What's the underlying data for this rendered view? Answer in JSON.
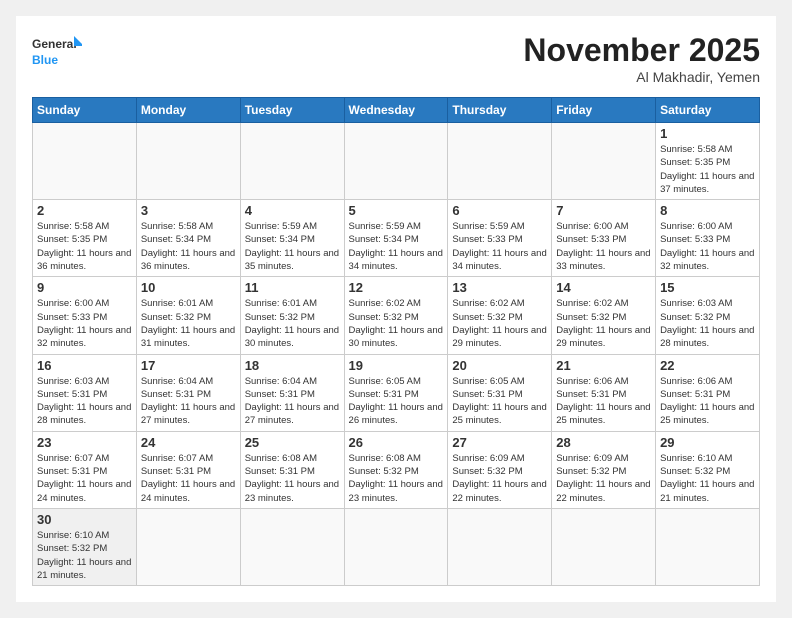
{
  "header": {
    "logo_general": "General",
    "logo_blue": "Blue",
    "title": "November 2025",
    "location": "Al Makhadir, Yemen"
  },
  "weekdays": [
    "Sunday",
    "Monday",
    "Tuesday",
    "Wednesday",
    "Thursday",
    "Friday",
    "Saturday"
  ],
  "weeks": [
    [
      {
        "day": "",
        "info": ""
      },
      {
        "day": "",
        "info": ""
      },
      {
        "day": "",
        "info": ""
      },
      {
        "day": "",
        "info": ""
      },
      {
        "day": "",
        "info": ""
      },
      {
        "day": "",
        "info": ""
      },
      {
        "day": "1",
        "info": "Sunrise: 5:58 AM\nSunset: 5:35 PM\nDaylight: 11 hours and 37 minutes."
      }
    ],
    [
      {
        "day": "2",
        "info": "Sunrise: 5:58 AM\nSunset: 5:35 PM\nDaylight: 11 hours and 36 minutes."
      },
      {
        "day": "3",
        "info": "Sunrise: 5:58 AM\nSunset: 5:34 PM\nDaylight: 11 hours and 36 minutes."
      },
      {
        "day": "4",
        "info": "Sunrise: 5:59 AM\nSunset: 5:34 PM\nDaylight: 11 hours and 35 minutes."
      },
      {
        "day": "5",
        "info": "Sunrise: 5:59 AM\nSunset: 5:34 PM\nDaylight: 11 hours and 34 minutes."
      },
      {
        "day": "6",
        "info": "Sunrise: 5:59 AM\nSunset: 5:33 PM\nDaylight: 11 hours and 34 minutes."
      },
      {
        "day": "7",
        "info": "Sunrise: 6:00 AM\nSunset: 5:33 PM\nDaylight: 11 hours and 33 minutes."
      },
      {
        "day": "8",
        "info": "Sunrise: 6:00 AM\nSunset: 5:33 PM\nDaylight: 11 hours and 32 minutes."
      }
    ],
    [
      {
        "day": "9",
        "info": "Sunrise: 6:00 AM\nSunset: 5:33 PM\nDaylight: 11 hours and 32 minutes."
      },
      {
        "day": "10",
        "info": "Sunrise: 6:01 AM\nSunset: 5:32 PM\nDaylight: 11 hours and 31 minutes."
      },
      {
        "day": "11",
        "info": "Sunrise: 6:01 AM\nSunset: 5:32 PM\nDaylight: 11 hours and 30 minutes."
      },
      {
        "day": "12",
        "info": "Sunrise: 6:02 AM\nSunset: 5:32 PM\nDaylight: 11 hours and 30 minutes."
      },
      {
        "day": "13",
        "info": "Sunrise: 6:02 AM\nSunset: 5:32 PM\nDaylight: 11 hours and 29 minutes."
      },
      {
        "day": "14",
        "info": "Sunrise: 6:02 AM\nSunset: 5:32 PM\nDaylight: 11 hours and 29 minutes."
      },
      {
        "day": "15",
        "info": "Sunrise: 6:03 AM\nSunset: 5:32 PM\nDaylight: 11 hours and 28 minutes."
      }
    ],
    [
      {
        "day": "16",
        "info": "Sunrise: 6:03 AM\nSunset: 5:31 PM\nDaylight: 11 hours and 28 minutes."
      },
      {
        "day": "17",
        "info": "Sunrise: 6:04 AM\nSunset: 5:31 PM\nDaylight: 11 hours and 27 minutes."
      },
      {
        "day": "18",
        "info": "Sunrise: 6:04 AM\nSunset: 5:31 PM\nDaylight: 11 hours and 27 minutes."
      },
      {
        "day": "19",
        "info": "Sunrise: 6:05 AM\nSunset: 5:31 PM\nDaylight: 11 hours and 26 minutes."
      },
      {
        "day": "20",
        "info": "Sunrise: 6:05 AM\nSunset: 5:31 PM\nDaylight: 11 hours and 25 minutes."
      },
      {
        "day": "21",
        "info": "Sunrise: 6:06 AM\nSunset: 5:31 PM\nDaylight: 11 hours and 25 minutes."
      },
      {
        "day": "22",
        "info": "Sunrise: 6:06 AM\nSunset: 5:31 PM\nDaylight: 11 hours and 25 minutes."
      }
    ],
    [
      {
        "day": "23",
        "info": "Sunrise: 6:07 AM\nSunset: 5:31 PM\nDaylight: 11 hours and 24 minutes."
      },
      {
        "day": "24",
        "info": "Sunrise: 6:07 AM\nSunset: 5:31 PM\nDaylight: 11 hours and 24 minutes."
      },
      {
        "day": "25",
        "info": "Sunrise: 6:08 AM\nSunset: 5:31 PM\nDaylight: 11 hours and 23 minutes."
      },
      {
        "day": "26",
        "info": "Sunrise: 6:08 AM\nSunset: 5:32 PM\nDaylight: 11 hours and 23 minutes."
      },
      {
        "day": "27",
        "info": "Sunrise: 6:09 AM\nSunset: 5:32 PM\nDaylight: 11 hours and 22 minutes."
      },
      {
        "day": "28",
        "info": "Sunrise: 6:09 AM\nSunset: 5:32 PM\nDaylight: 11 hours and 22 minutes."
      },
      {
        "day": "29",
        "info": "Sunrise: 6:10 AM\nSunset: 5:32 PM\nDaylight: 11 hours and 21 minutes."
      }
    ],
    [
      {
        "day": "30",
        "info": "Sunrise: 6:10 AM\nSunset: 5:32 PM\nDaylight: 11 hours and 21 minutes."
      },
      {
        "day": "",
        "info": ""
      },
      {
        "day": "",
        "info": ""
      },
      {
        "day": "",
        "info": ""
      },
      {
        "day": "",
        "info": ""
      },
      {
        "day": "",
        "info": ""
      },
      {
        "day": "",
        "info": ""
      }
    ]
  ]
}
